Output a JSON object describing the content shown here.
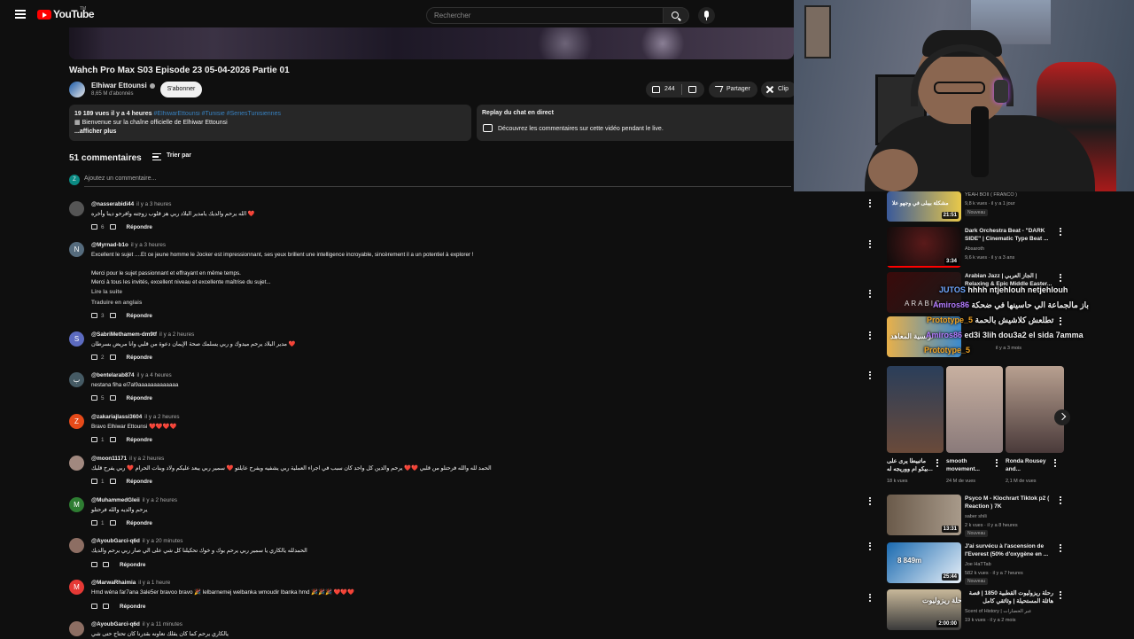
{
  "header": {
    "logo_text": "YouTube",
    "logo_tm": "TM",
    "search_placeholder": "Rechercher"
  },
  "video": {
    "title": "Wahch Pro Max S03 Episode 23 05-04-2026 Partie 01",
    "channel_name": "Elhiwar Ettounsi",
    "subscribers": "8,65 M d'abonnés",
    "subscribe_label": "S'abonner",
    "likes": "244",
    "share_label": "Partager",
    "clip_label": "Clip"
  },
  "description": {
    "stats": "19 189 vues  il y a 4 heures",
    "tags": "#ElhiwarEttounsi #Tunisie #SeriesTunisiennes",
    "line": "Bienvenue sur la chaîne officielle de Elhiwar Ettounsi",
    "more": "...afficher plus"
  },
  "replay": {
    "title": "Replay du chat en direct",
    "subtitle": "Découvrez les commentaires sur cette vidéo pendant le live."
  },
  "comments_section": {
    "count_label": "51 commentaires",
    "sort_label": "Trier par",
    "my_avatar_letter": "Z",
    "add_placeholder": "Ajoutez un commentaire..."
  },
  "comments": [
    {
      "handle": "@nasserabidi44",
      "time": "il y a 3 heures",
      "text": "الله يرحم والديك يامدير البلاد ربي هز قلوب زوجته وافرحو دينا وأخره ❤️",
      "likes": "6",
      "avatar": "",
      "color": "#555"
    },
    {
      "handle": "@Myrnad-b1o",
      "time": "il y a 3 heures",
      "text": "Excellent le sujet ....Et ce jeune homme le Jocker est impressionnant, ses yeux brillent une intelligence incroyable, sincèrement il a un potentiel à explorer !",
      "text2": "Merci pour le sujet passionnant et effrayant en même temps.",
      "text3": "Merci à tous les invités, excellent niveau et excellente maîtrise du sujet...",
      "more": "Lire la suite",
      "translate": "Traduire en anglais",
      "likes": "3",
      "avatar": "N",
      "color": "#556b7d"
    },
    {
      "handle": "@SabriMethamem-dm9tf",
      "time": "il y a 2 heures",
      "text": "مدير البلاد يرحم ميدوك و ربي يسلمك صحة الإيمان دعوة من قلبي وانا مريض بسرطان ❤️",
      "likes": "2",
      "avatar": "S",
      "color": "#5c6bc0"
    },
    {
      "handle": "@bentelarab874",
      "time": "il y a 4 heures",
      "text": "nestana fiha el7al9aaaaaaaaaaaaa",
      "likes": "5",
      "avatar": "ب",
      "color": "#455a64"
    },
    {
      "handle": "@zakariajlassi3604",
      "time": "il y a 2 heures",
      "text": "Bravo Elhiwar Ettounsi ❤️❤️❤️❤️",
      "likes": "1",
      "avatar": "Z",
      "color": "#e64a19"
    },
    {
      "handle": "@moon11171",
      "time": "il y a 2 heures",
      "text": "الحمد لله والله فرحتلو من قلبي ❤️❤️ يرحم والدين كل واحد كان سبب في اجراء العملية ربي يشفيه ويفرح عايلتو ❤️ سمير ربي يبعد عليكم ولاد وبنات الحرام ❤️ ربي يفرح قلبك",
      "likes": "1",
      "avatar": "",
      "color": "#a1887f"
    },
    {
      "handle": "@MuhammedGleii",
      "time": "il y a 2 heures",
      "text": "يرحم والديه والله فرحتلو",
      "likes": "1",
      "avatar": "M",
      "color": "#2e7d32"
    },
    {
      "handle": "@AyoubGarci-q6d",
      "time": "il y a 20 minutes",
      "text": "الحمدلله يالكاري يا سمير ربي يرحم بوك و خوك تحكيلنا كل شي على الي صار ربي يرحم والديك",
      "likes": "",
      "avatar": "",
      "color": "#8d6e63"
    },
    {
      "handle": "@MarwaRhaimia",
      "time": "il y a 1 heure",
      "text": "Hmd wéna far7ana 3ale5er bravoo bravo 🎉 lelbarnemej welbanka wmoudir lbanka hmd 🎉🎉🎉 ❤️❤️❤️",
      "likes": "",
      "avatar": "M",
      "color": "#e53935"
    },
    {
      "handle": "@AyoubGarci-q6d",
      "time": "il y a 11 minutes",
      "text": "يالكاري يرحم كما كان يقلك نعاونه بقدرنا كان تحتاج حتى شي",
      "likes": "",
      "avatar": "",
      "color": "#8d6e63"
    }
  ],
  "reply_label": "Répondre",
  "sidebar": [
    {
      "title": "",
      "channel": "YEAH BOII ( FRANCO )",
      "meta": "9,8 k vues · il y a 1 jour",
      "badge": "Nouveau",
      "duration": "21:51",
      "thumb_text": "مشكلة بيبلى في وجهو علا"
    },
    {
      "title": "Dark Orchestra Beat - \"DARK SIDE\" | Cinematic Type Beat ...",
      "channel": "Absaroth",
      "meta": "9,6 k vues · il y a 3 ans",
      "duration": "3:34"
    },
    {
      "title": "Arabian Jazz | الجاز العربي | Relaxing & Epic Middle Easter...",
      "channel": "",
      "meta": "",
      "thumb_text": "ARABIC"
    },
    {
      "title": "",
      "channel": "",
      "meta": "il y a 3 mois",
      "thumb_text": "تونسية المعاهد"
    },
    {
      "title": "Psyco M - Klochrart Tiktok p2 ( Reaction ) 7K",
      "channel": "saber shili",
      "meta": "2 k vues · il y a 8 heures",
      "badge": "Nouveau",
      "duration": "13:31"
    },
    {
      "title": "J'ai survécu à l'ascension de l'Everest (50% d'oxygène en ...",
      "channel": "Joe HaTTab",
      "meta": "582 k vues · il y a 7 heures",
      "badge": "Nouveau",
      "duration": "25:44",
      "thumb_text": "8 849m"
    },
    {
      "title": "رحلة ريزوليوت القطبية 1850 | قصة هائلة المستحيلة | وثائقي كامل",
      "channel": "Scent of History | عبر الحضارات",
      "meta": "19 k vues · il y a 2 mois",
      "duration": "2:00:00",
      "thumb_text": "رحلة ريزوليوت"
    }
  ],
  "shorts": [
    {
      "title": "ماتبيطا يرى على ...بيكو ام ووريجه له",
      "views": "18 k vues"
    },
    {
      "title": "smooth movement...",
      "views": "24 M de vues"
    },
    {
      "title": "Ronda Rousey and...",
      "views": "2,1 M de vues"
    }
  ],
  "chat_overlay": [
    {
      "user": "JUTOS",
      "msg": "hhhh ntjehlouh netjehlouh",
      "color": "#6fa8ff"
    },
    {
      "user": "Amiros86",
      "msg": "باز مالجماعة الي حاسينها في ضحكة",
      "color": "#b37bff"
    },
    {
      "user": "Prototype_5",
      "msg": "تطلعش كلاشيش بالحمة",
      "color": "#f5a623"
    },
    {
      "user": "Amiros86",
      "msg": "ed3i 3lih dou3a2 el sida 7amma",
      "color": "#b37bff"
    },
    {
      "user": "Prototype_5",
      "msg": "",
      "color": "#f5a623"
    }
  ]
}
